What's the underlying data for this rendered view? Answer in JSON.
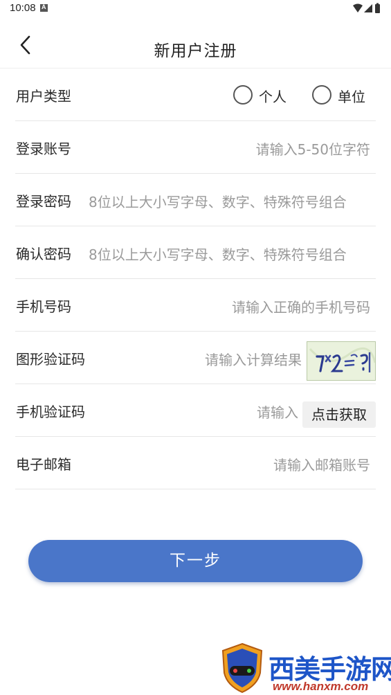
{
  "status_bar": {
    "time": "10:08"
  },
  "header": {
    "title": "新用户注册"
  },
  "form": {
    "user_type": {
      "label": "用户类型",
      "options": [
        "个人",
        "单位"
      ]
    },
    "account": {
      "label": "登录账号",
      "placeholder": "请输入5-50位字符"
    },
    "password": {
      "label": "登录密码",
      "placeholder": "8位以上大小写字母、数字、特殊符号组合"
    },
    "confirm_password": {
      "label": "确认密码",
      "placeholder": "8位以上大小写字母、数字、特殊符号组合"
    },
    "phone": {
      "label": "手机号码",
      "placeholder": "请输入正确的手机号码"
    },
    "captcha": {
      "label": "图形验证码",
      "placeholder": "请输入计算结果"
    },
    "sms_code": {
      "label": "手机验证码",
      "placeholder": "请输入",
      "button": "点击获取"
    },
    "email": {
      "label": "电子邮箱",
      "placeholder": "请输入邮箱账号"
    }
  },
  "next_button": "下一步",
  "watermark": {
    "brand": "西美手游网",
    "url": "www.hanxm.com"
  },
  "colors": {
    "primary": "#4a76c9",
    "brand_blue": "#1d55c8",
    "url_red": "#c0392b"
  },
  "icons": {
    "back": "chevron-left-icon",
    "wifi": "wifi-icon",
    "signal": "signal-icon",
    "battery": "battery-icon"
  }
}
